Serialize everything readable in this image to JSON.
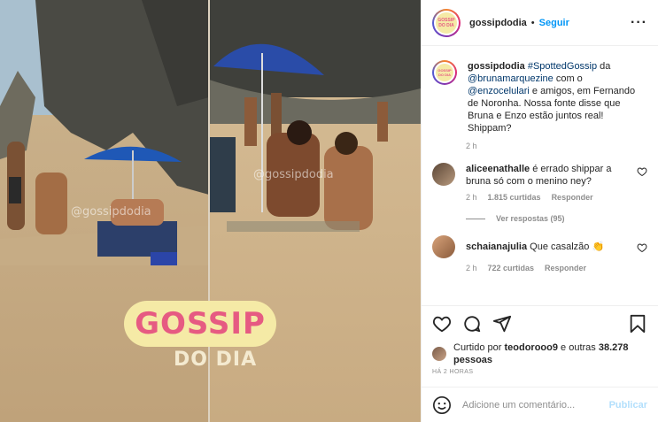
{
  "post": {
    "username": "gossipdodia",
    "follow_label": "Seguir",
    "more_icon": "more-options-icon",
    "image": {
      "watermark_text": "@gossipdodia",
      "logo_top": "GOSSIP",
      "logo_bottom": "DO DIA"
    },
    "caption": {
      "username": "gossipdodia",
      "text_1": "#SpottedGossip",
      "text_2": " da ",
      "mention_1": "@brunamarquezine",
      "text_3": " com o ",
      "mention_2": "@enzocelulari",
      "text_4": " e amigos, em Fernando de Noronha. Nossa fonte disse que Bruna e Enzo estão juntos real! Shippam?",
      "time": "2 h"
    },
    "comments": [
      {
        "username": "aliceenathalle",
        "text": "é errado shippar a bruna só com o menino ney?",
        "time": "2 h",
        "likes": "1.815 curtidas",
        "reply_label": "Responder",
        "view_replies": "Ver respostas (95)"
      },
      {
        "username": "schaianajulia",
        "text": "Que casalzão 👏",
        "time": "2 h",
        "likes": "722 curtidas",
        "reply_label": "Responder"
      }
    ],
    "liked_by": {
      "prefix": "Curtido por ",
      "user": "teodorooo9",
      "middle": " e outras ",
      "count": "38.278 pessoas"
    },
    "timestamp": "HÁ 2 HORAS",
    "comment_box": {
      "placeholder": "Adicione um comentário...",
      "publish_label": "Publicar"
    },
    "colors": {
      "accent": "#0095f6",
      "publish_disabled": "#b2dffc",
      "link": "#00376b",
      "muted": "#8e8e8e"
    }
  }
}
